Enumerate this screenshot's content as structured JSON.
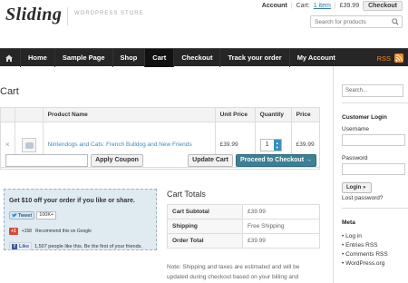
{
  "header": {
    "logo": "Sliding",
    "tagline": "WORDPRESS STORE",
    "account": "Account",
    "cart_label": "Cart:",
    "cart_items": "1 item",
    "cart_total": "£39.99",
    "checkout": "Checkout",
    "search_placeholder": "Search for products"
  },
  "nav": {
    "items": [
      "Home",
      "Sample Page",
      "Shop",
      "Cart",
      "Checkout",
      "Track your order",
      "My Account"
    ],
    "active": "Cart",
    "rss": "RSS"
  },
  "page_title": "Cart",
  "cart": {
    "columns": [
      "Product Name",
      "Unit Price",
      "Quantity",
      "Price"
    ],
    "rows": [
      {
        "remove": "×",
        "name": "Nintendogs and Cats: French Bulldog and New Friends",
        "unit_price": "£39.99",
        "quantity": "1",
        "price": "£39.99"
      }
    ],
    "apply_coupon": "Apply Coupon",
    "update_cart": "Update Cart",
    "proceed": "Proceed to Checkout →"
  },
  "share": {
    "headline": "Get $10 off your order if you like or share.",
    "tweet": "Tweet",
    "tweet_count": "100K+",
    "gplus": "+1",
    "gplus_count": "+158",
    "gplus_text": "Recommend this on Google",
    "fb_like": "Like",
    "fb_text": "1,507 people like this. Be the first of your friends."
  },
  "totals": {
    "title": "Cart Totals",
    "rows": [
      {
        "label": "Cart Subtotal",
        "value": "£39.99"
      },
      {
        "label": "Shipping",
        "value": "Free Shipping"
      },
      {
        "label": "Order Total",
        "value": "£39.99"
      }
    ],
    "note": "Note: Shipping and taxes are estimated and will be updated during checkout based on your billing and shipping information."
  },
  "sidebar": {
    "search_placeholder": "Search...",
    "login_title": "Customer Login",
    "username": "Username",
    "password": "Password",
    "login_btn": "Login »",
    "lost_password": "Lost password?",
    "meta_title": "Meta",
    "meta_links": [
      "Log in",
      "Entries RSS",
      "Comments RSS",
      "WordPress.org"
    ]
  },
  "colors": {
    "nav_bg": "#262626",
    "proceed_bg": "#3d7f95",
    "link": "#3a8dbf",
    "rss": "#f08c24",
    "share_bg": "#dfeaf1"
  }
}
